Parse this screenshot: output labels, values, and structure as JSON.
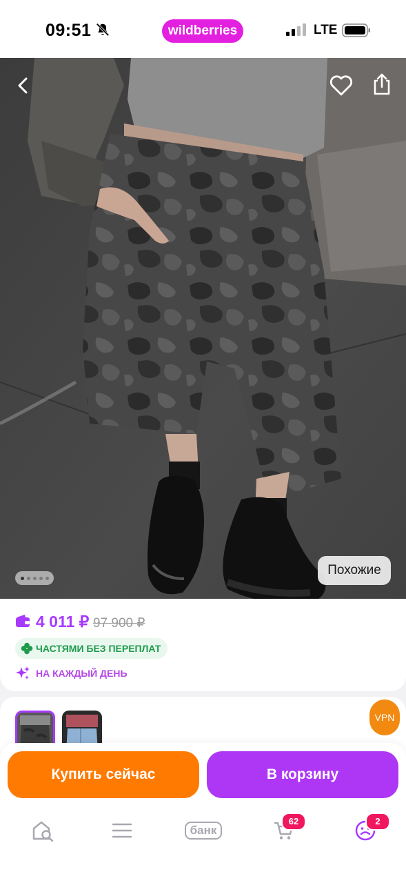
{
  "status_bar": {
    "time": "09:51",
    "network": "LTE",
    "brand": "wildberries"
  },
  "product": {
    "gallery": {
      "similar_label": "Похожие",
      "dots_count": 5,
      "active_dot": 0
    },
    "price": "4 011 ₽",
    "old_price": "97 900 ₽",
    "badges": {
      "installments": "ЧАСТЯМИ БЕЗ ПЕРЕПЛАТ",
      "every_day": "НА КАЖДЫЙ ДЕНЬ"
    }
  },
  "vpn_label": "VPN",
  "actions": {
    "buy_now": "Купить сейчас",
    "add_to_cart": "В корзину"
  },
  "tab_bar": {
    "bank_label": "банк",
    "cart_count": "62",
    "profile_count": "2"
  },
  "colors": {
    "brand": "#e31fe0",
    "price_purple": "#a73afd",
    "buy_orange": "#ff7a00",
    "cart_purple": "#ae37f5",
    "badge_red": "#f0175f",
    "green": "#1f9a4c"
  },
  "icons": [
    "bell-off-icon",
    "back-arrow-icon",
    "heart-icon",
    "share-icon",
    "wallet-icon",
    "clover-icon",
    "sparkle-icon",
    "home-search-icon",
    "menu-icon",
    "cart-icon",
    "profile-icon"
  ]
}
